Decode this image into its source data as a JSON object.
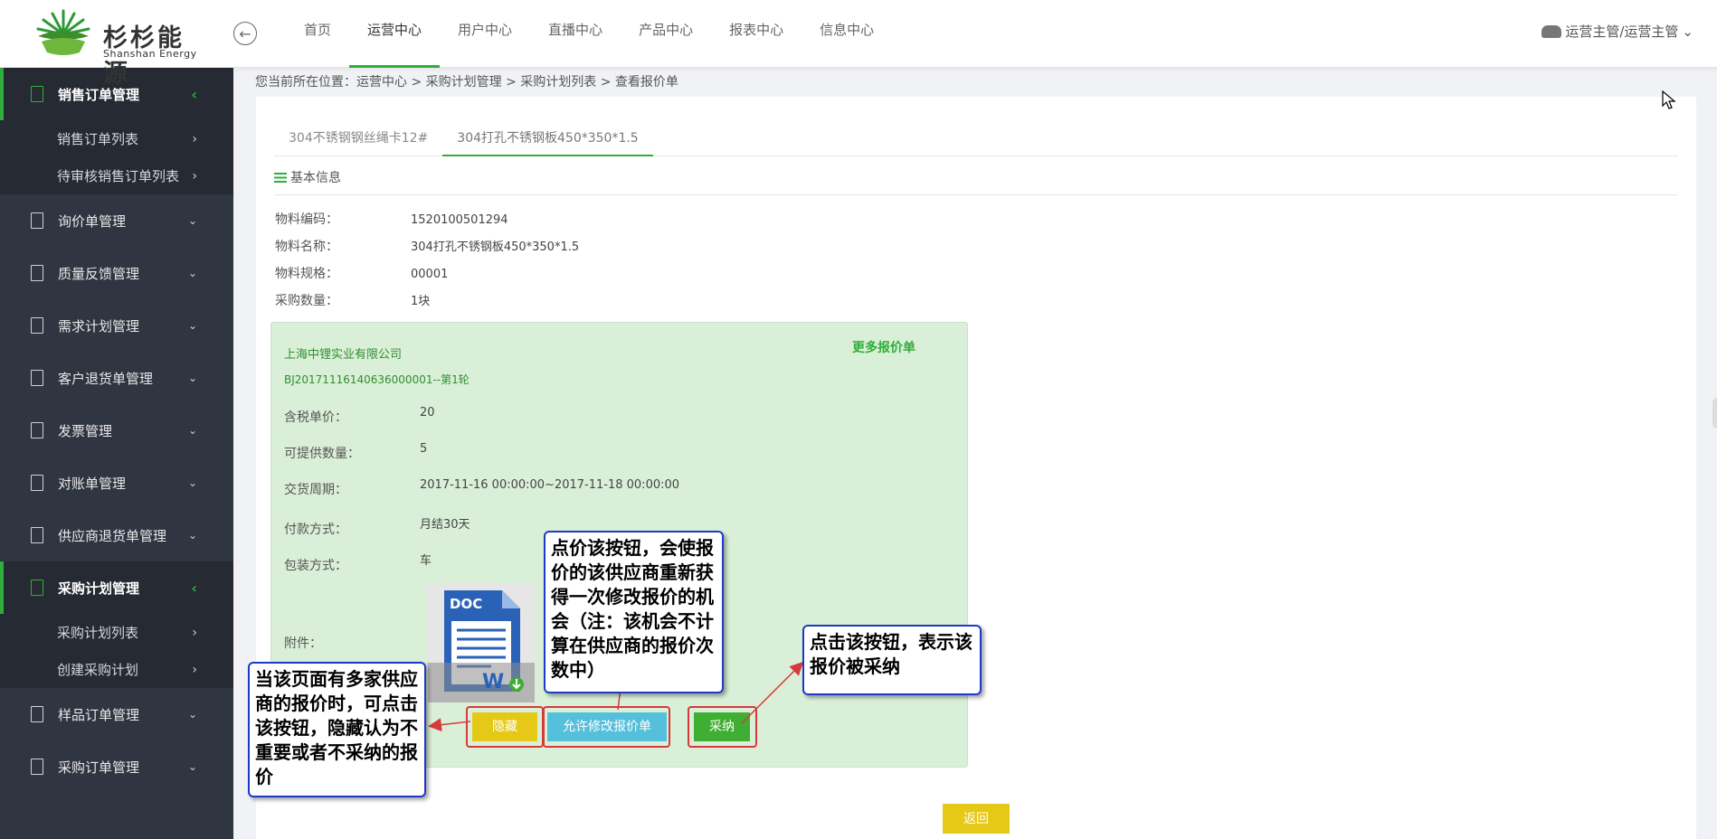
{
  "brand": {
    "name_cn": "杉杉能源",
    "name_en": "Shanshan Energy"
  },
  "nav": [
    "首页",
    "运营中心",
    "用户中心",
    "直播中心",
    "产品中心",
    "报表中心",
    "信息中心"
  ],
  "nav_active": "运营中心",
  "user": {
    "label": "运营主管/运营主管",
    "icon": "user-hat-icon",
    "caret": "⌄"
  },
  "sidebar": {
    "groups": [
      {
        "label": "销售订单管理",
        "open": true,
        "children": [
          "销售订单列表",
          "待审核销售订单列表"
        ]
      },
      {
        "label": "询价单管理"
      },
      {
        "label": "质量反馈管理"
      },
      {
        "label": "需求计划管理"
      },
      {
        "label": "客户退货单管理"
      },
      {
        "label": "发票管理"
      },
      {
        "label": "对账单管理"
      },
      {
        "label": "供应商退货单管理"
      },
      {
        "label": "采购计划管理",
        "open": true,
        "children": [
          "采购计划列表",
          "创建采购计划"
        ]
      },
      {
        "label": "样品订单管理"
      },
      {
        "label": "采购订单管理"
      }
    ]
  },
  "breadcrumb": "您当前所在位置：运营中心 > 采购计划管理 > 采购计划列表 > 查看报价单",
  "tabs": [
    "304不锈钢钢丝绳卡12#",
    "304打孔不锈钢板450*350*1.5"
  ],
  "active_tab_index": 1,
  "section_title": "基本信息",
  "info": {
    "code": {
      "label": "物料编码：",
      "value": "1520100501294"
    },
    "name": {
      "label": "物料名称：",
      "value": "304打孔不锈钢板450*350*1.5"
    },
    "spec": {
      "label": "物料规格：",
      "value": "00001"
    },
    "qty": {
      "label": "采购数量：",
      "value": "1块"
    }
  },
  "quote": {
    "company": "上海中锂实业有限公司",
    "code": "BJ20171116140636000001--第1轮",
    "more_link": "更多报价单",
    "unit_price": {
      "label": "含税单价：",
      "value": "20"
    },
    "available_qty": {
      "label": "可提供数量：",
      "value": "5"
    },
    "delivery": {
      "label": "交货周期：",
      "value": "2017-11-16 00:00:00~2017-11-18 00:00:00"
    },
    "payment": {
      "label": "付款方式：",
      "value": "月结30天"
    },
    "packing": {
      "label": "包装方式：",
      "value": "车"
    },
    "attachment": {
      "label": "附件：",
      "file_type": "DOC"
    },
    "buttons": {
      "hide": "隐藏",
      "allow_modify": "允许修改报价单",
      "adopt": "采纳"
    }
  },
  "back_button": "返回",
  "callouts": {
    "hide": "当该页面有多家供应商的报价时，可点击该按钮，隐藏认为不重要或者不采纳的报价",
    "allow": "点价该按钮，会使报价的该供应商重新获得一次修改报价的机会（注：该机会不计算在供应商的报价次数中）",
    "adopt": "点击该按钮，表示该报价被采纳"
  },
  "colors": {
    "accent_green": "#2fae3a",
    "sidebar_bg": "#2f3541",
    "quote_bg": "#daefd7",
    "btn_yellow": "#e6c916",
    "btn_cyan": "#55c0dc",
    "btn_green": "#3fae33",
    "callout_border": "#1c3ac8",
    "highlight_red": "#d63a3a"
  }
}
